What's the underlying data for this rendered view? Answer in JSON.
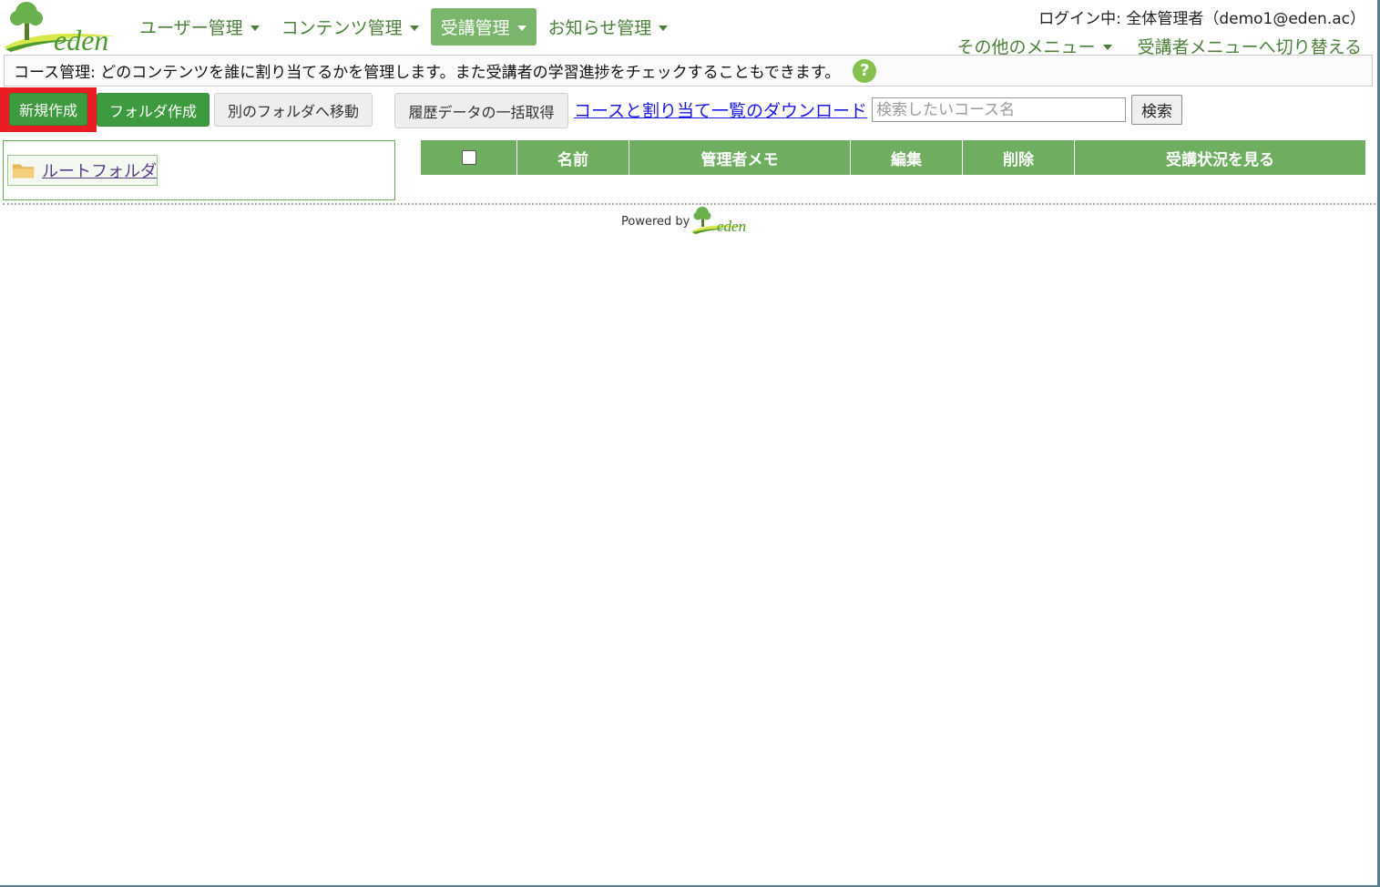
{
  "brand": {
    "logo_text": "eden",
    "tree_color": "#6ab04c",
    "swoosh_color": "#d8e84a"
  },
  "nav": {
    "items": [
      {
        "label": "ユーザー管理",
        "active": false
      },
      {
        "label": "コンテンツ管理",
        "active": false
      },
      {
        "label": "受講管理",
        "active": true
      },
      {
        "label": "お知らせ管理",
        "active": false
      }
    ]
  },
  "header": {
    "login_status": "ログイン中: 全体管理者（demo1@eden.ac）",
    "other_menu_label": "その他のメニュー",
    "switch_menu_label": "受講者メニューへ切り替える"
  },
  "description": {
    "text": "コース管理: どのコンテンツを誰に割り当てるかを管理します。また受講者の学習進捗をチェックすることもできます。",
    "help_icon": "?"
  },
  "toolbar": {
    "new_label": "新規作成",
    "new_folder_label": "フォルダ作成",
    "move_label": "別のフォルダへ移動",
    "history_label": "履歴データの一括取得",
    "download_link": "コースと割り当て一覧のダウンロード",
    "search_placeholder": "検索したいコース名",
    "search_button": "検索"
  },
  "folder_tree": {
    "root_label": "ルートフォルダ",
    "icon": "folder-icon"
  },
  "table": {
    "columns": [
      "名前",
      "管理者メモ",
      "編集",
      "削除",
      "受講状況を見る"
    ],
    "rows": []
  },
  "footer": {
    "powered_by": "Powered by",
    "logo_text": "eden"
  },
  "colors": {
    "accent_green": "#3e9a3e",
    "nav_text": "#4b7f3a",
    "table_header": "#6fae60",
    "highlight": "#ea1c24"
  }
}
